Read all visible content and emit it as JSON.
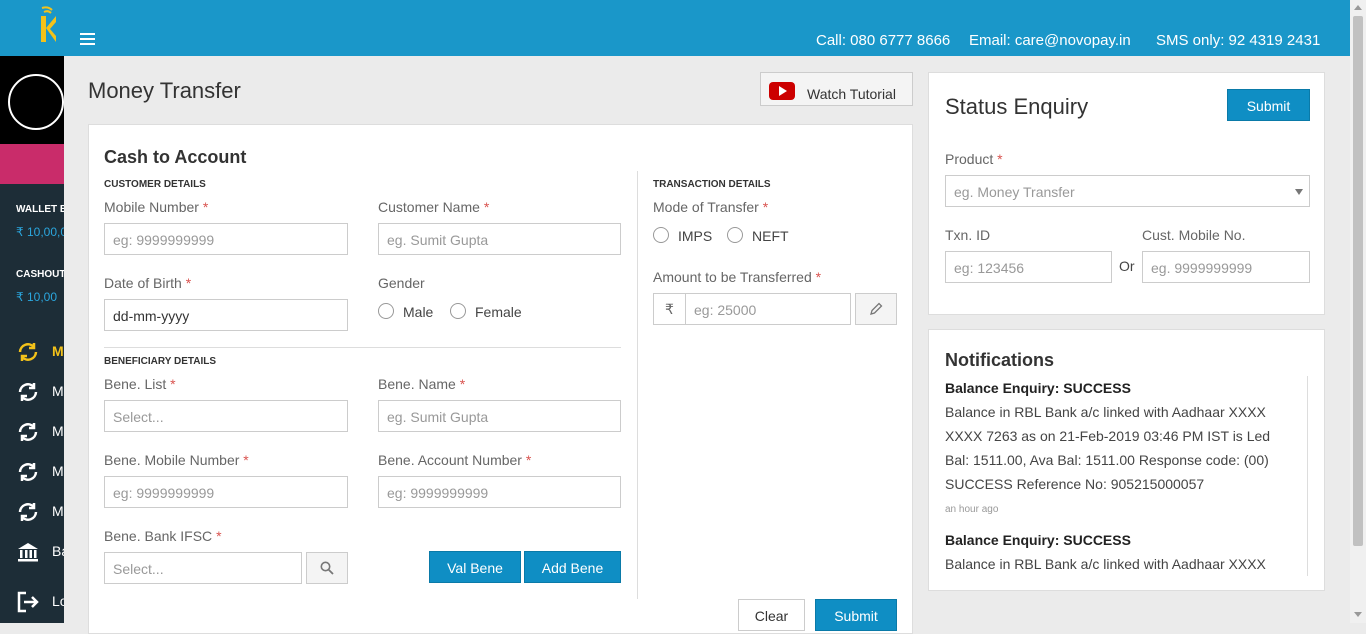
{
  "header": {
    "call": "Call: 080 6777 8666",
    "email": "Email: care@novopay.in",
    "sms": "SMS only: 92 4319 2431"
  },
  "sidebar": {
    "wallet_label": "WALLET B",
    "wallet_value": "₹ 10,00,0",
    "cashout_label": "CASHOUT",
    "cashout_value": "₹ 10,00",
    "items": [
      {
        "label": "M",
        "icon": "refresh-icon"
      },
      {
        "label": "M",
        "icon": "refresh-icon"
      },
      {
        "label": "M",
        "icon": "refresh-icon"
      },
      {
        "label": "M",
        "icon": "refresh-icon"
      },
      {
        "label": "M",
        "icon": "refresh-icon"
      },
      {
        "label": "Ba",
        "icon": "bank-icon"
      },
      {
        "label": "Lo",
        "icon": "logout-icon"
      }
    ]
  },
  "page": {
    "title": "Money Transfer",
    "tutorial": "Watch Tutorial"
  },
  "form": {
    "title": "Cash to Account",
    "customer_section": "CUSTOMER DETAILS",
    "mobile_label": "Mobile Number",
    "mobile_placeholder": "eg: 9999999999",
    "name_label": "Customer Name",
    "name_placeholder": "eg. Sumit Gupta",
    "dob_label": "Date of Birth",
    "dob_value": "dd-mm-yyyy",
    "gender_label": "Gender",
    "gender_male": "Male",
    "gender_female": "Female",
    "bene_section": "BENEFICIARY DETAILS",
    "bene_list_label": "Bene. List",
    "bene_list_placeholder": "Select...",
    "bene_name_label": "Bene. Name",
    "bene_name_placeholder": "eg. Sumit Gupta",
    "bene_mobile_label": "Bene. Mobile Number",
    "bene_mobile_placeholder": "eg: 9999999999",
    "bene_account_label": "Bene. Account Number",
    "bene_account_placeholder": "eg: 9999999999",
    "bene_ifsc_label": "Bene. Bank IFSC",
    "bene_ifsc_placeholder": "Select...",
    "val_bene": "Val Bene",
    "add_bene": "Add Bene",
    "txn_section": "TRANSACTION DETAILS",
    "mode_label": "Mode of Transfer",
    "mode_imps": "IMPS",
    "mode_neft": "NEFT",
    "amount_label": "Amount to be Transferred",
    "amount_prefix": "₹",
    "amount_placeholder": "eg: 25000",
    "clear": "Clear",
    "submit": "Submit",
    "required_mark": "*"
  },
  "status": {
    "title": "Status Enquiry",
    "submit": "Submit",
    "product_label": "Product",
    "product_placeholder": "eg. Money Transfer",
    "txn_label": "Txn. ID",
    "txn_placeholder": "eg: 123456",
    "or": "Or",
    "cust_label": "Cust. Mobile No.",
    "cust_placeholder": "eg. 9999999999"
  },
  "notifications": {
    "title": "Notifications",
    "items": [
      {
        "title": "Balance Enquiry: SUCCESS",
        "message": "Balance in RBL Bank a/c linked with Aadhaar XXXX XXXX 7263 as on 21-Feb-2019 03:46 PM IST is Led Bal: 1511.00, Ava Bal: 1511.00 Response code: (00) SUCCESS Reference No: 905215000057",
        "time": "an hour ago"
      },
      {
        "title": "Balance Enquiry: SUCCESS",
        "message": "Balance in RBL Bank a/c linked with Aadhaar XXXX"
      }
    ]
  },
  "colors": {
    "header": "#1a97c9",
    "sidebar": "#1d2d37",
    "accent": "#0f8ec4",
    "active": "#f3c21a",
    "pink": "#c92c6a"
  }
}
